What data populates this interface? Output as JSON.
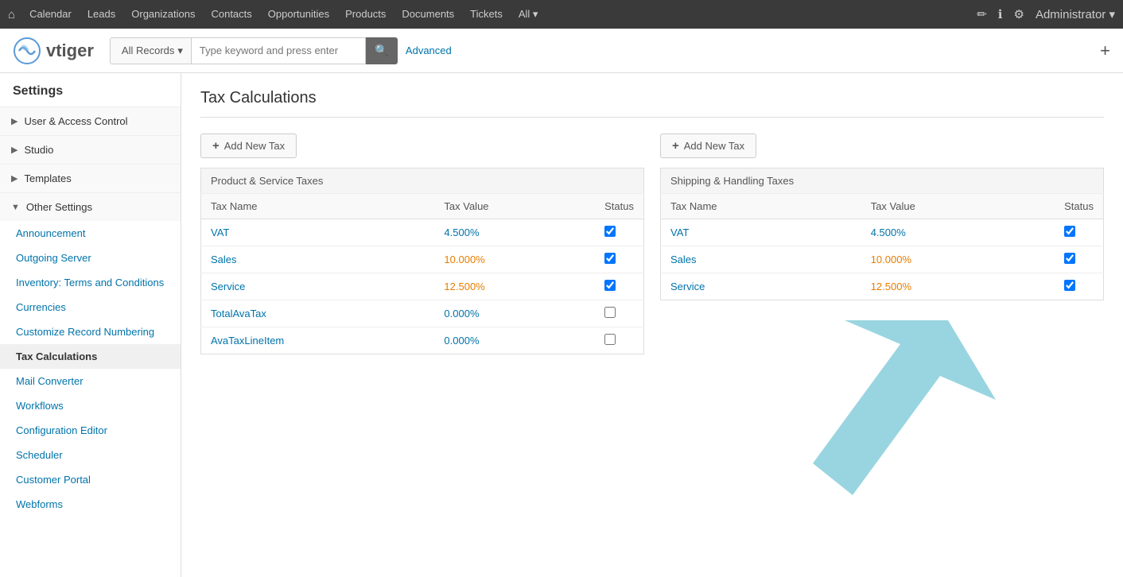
{
  "topnav": {
    "home_icon": "⌂",
    "links": [
      "Calendar",
      "Leads",
      "Organizations",
      "Contacts",
      "Opportunities",
      "Products",
      "Documents",
      "Tickets",
      "All"
    ],
    "right_icons": [
      "✏",
      "ℹ",
      "⚙"
    ],
    "admin_label": "Administrator"
  },
  "header": {
    "logo_text": "vtiger",
    "search_dropdown": "All Records",
    "search_placeholder": "Type keyword and press enter",
    "search_icon": "🔍",
    "advanced_label": "Advanced",
    "plus_icon": "+"
  },
  "sidebar": {
    "title": "Settings",
    "sections": [
      {
        "id": "user-access",
        "label": "User & Access Control",
        "expanded": false,
        "items": []
      },
      {
        "id": "studio",
        "label": "Studio",
        "expanded": false,
        "items": []
      },
      {
        "id": "templates",
        "label": "Templates",
        "expanded": false,
        "items": []
      },
      {
        "id": "other-settings",
        "label": "Other Settings",
        "expanded": true,
        "items": [
          {
            "id": "announcement",
            "label": "Announcement",
            "active": false
          },
          {
            "id": "outgoing-server",
            "label": "Outgoing Server",
            "active": false
          },
          {
            "id": "inventory-terms",
            "label": "Inventory: Terms and Conditions",
            "active": false
          },
          {
            "id": "currencies",
            "label": "Currencies",
            "active": false
          },
          {
            "id": "customize-record",
            "label": "Customize Record Numbering",
            "active": false
          },
          {
            "id": "tax-calculations",
            "label": "Tax Calculations",
            "active": true
          },
          {
            "id": "mail-converter",
            "label": "Mail Converter",
            "active": false
          },
          {
            "id": "workflows",
            "label": "Workflows",
            "active": false
          },
          {
            "id": "configuration-editor",
            "label": "Configuration Editor",
            "active": false
          },
          {
            "id": "scheduler",
            "label": "Scheduler",
            "active": false
          },
          {
            "id": "customer-portal",
            "label": "Customer Portal",
            "active": false
          },
          {
            "id": "webforms",
            "label": "Webforms",
            "active": false
          }
        ]
      }
    ]
  },
  "main": {
    "page_title": "Tax Calculations",
    "add_tax_label": "+ Add New Tax",
    "product_taxes": {
      "section_title": "Product & Service Taxes",
      "columns": [
        "Tax Name",
        "Tax Value",
        "Status"
      ],
      "rows": [
        {
          "name": "VAT",
          "value": "4.500%",
          "checked": true,
          "value_class": "blue"
        },
        {
          "name": "Sales",
          "value": "10.000%",
          "checked": true,
          "value_class": "orange"
        },
        {
          "name": "Service",
          "value": "12.500%",
          "checked": true,
          "value_class": "orange"
        },
        {
          "name": "TotalAvaTax",
          "value": "0.000%",
          "checked": false,
          "value_class": "blue"
        },
        {
          "name": "AvaTaxLineItem",
          "value": "0.000%",
          "checked": false,
          "value_class": "blue"
        }
      ]
    },
    "shipping_taxes": {
      "section_title": "Shipping & Handling Taxes",
      "columns": [
        "Tax Name",
        "Tax Value",
        "Status"
      ],
      "rows": [
        {
          "name": "VAT",
          "value": "4.500%",
          "checked": true,
          "value_class": "blue"
        },
        {
          "name": "Sales",
          "value": "10.000%",
          "checked": true,
          "value_class": "orange"
        },
        {
          "name": "Service",
          "value": "12.500%",
          "checked": true,
          "value_class": "orange"
        }
      ]
    }
  }
}
